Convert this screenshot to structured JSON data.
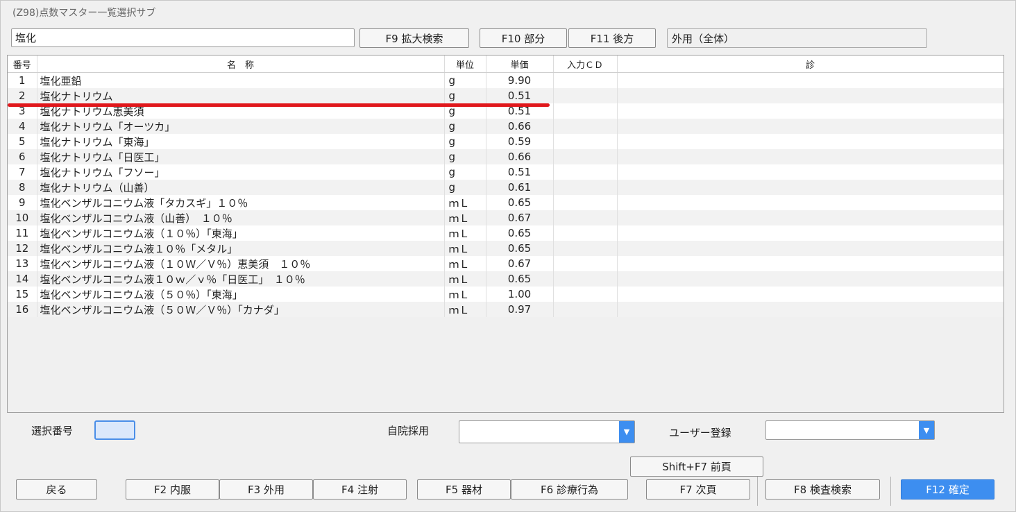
{
  "window": {
    "title": "(Z98)点数マスター一覧選択サブ"
  },
  "search": {
    "value": "塩化"
  },
  "top_buttons": {
    "f9": "F9 拡大検索",
    "f10": "F10 部分",
    "f11": "F11 後方"
  },
  "category_display": "外用（全体）",
  "table": {
    "headers": {
      "no": "番号",
      "name": "名　称",
      "unit": "単位",
      "price": "単価",
      "input_cd": "入力ＣＤ",
      "shin": "診"
    },
    "rows": [
      {
        "no": "1",
        "name": "塩化亜鉛",
        "unit": "g",
        "price": "9.90"
      },
      {
        "no": "2",
        "name": "塩化ナトリウム",
        "unit": "g",
        "price": "0.51"
      },
      {
        "no": "3",
        "name": "塩化ナトリウム恵美須",
        "unit": "g",
        "price": "0.51"
      },
      {
        "no": "4",
        "name": "塩化ナトリウム「オーツカ」",
        "unit": "g",
        "price": "0.66"
      },
      {
        "no": "5",
        "name": "塩化ナトリウム「東海」",
        "unit": "g",
        "price": "0.59"
      },
      {
        "no": "6",
        "name": "塩化ナトリウム「日医工」",
        "unit": "g",
        "price": "0.66"
      },
      {
        "no": "7",
        "name": "塩化ナトリウム「フソー」",
        "unit": "g",
        "price": "0.51"
      },
      {
        "no": "8",
        "name": "塩化ナトリウム（山善）",
        "unit": "g",
        "price": "0.61"
      },
      {
        "no": "9",
        "name": "塩化ベンザルコニウム液「タカスギ」１０％",
        "unit": "ｍＬ",
        "price": "0.65"
      },
      {
        "no": "10",
        "name": "塩化ベンザルコニウム液（山善）　１０％",
        "unit": "ｍＬ",
        "price": "0.67"
      },
      {
        "no": "11",
        "name": "塩化ベンザルコニウム液（１０％）「東海」",
        "unit": "ｍＬ",
        "price": "0.65"
      },
      {
        "no": "12",
        "name": "塩化ベンザルコニウム液１０％「メタル」",
        "unit": "ｍＬ",
        "price": "0.65"
      },
      {
        "no": "13",
        "name": "塩化ベンザルコニウム液（１０Ｗ／Ｖ％）恵美須　１０％",
        "unit": "ｍＬ",
        "price": "0.67"
      },
      {
        "no": "14",
        "name": "塩化ベンザルコニウム液１０ｗ／ｖ％「日医工」　１０％",
        "unit": "ｍＬ",
        "price": "0.65"
      },
      {
        "no": "15",
        "name": "塩化ベンザルコニウム液（５０％）「東海」",
        "unit": "ｍＬ",
        "price": "1.00"
      },
      {
        "no": "16",
        "name": "塩化ベンザルコニウム液（５０Ｗ／Ｖ％）「カナダ」",
        "unit": "ｍＬ",
        "price": "0.97"
      }
    ]
  },
  "form": {
    "selection_label": "選択番号",
    "selection_value": "",
    "in_hospital_label": "自院採用",
    "in_hospital_value": "",
    "user_reg_label": "ユーザー登録",
    "user_reg_value": ""
  },
  "bottom_buttons": {
    "back": "戻る",
    "f2": "F2 内服",
    "f3": "F3 外用",
    "f4": "F4 注射",
    "f5": "F5 器材",
    "f6": "F6 診療行為",
    "shift_f7": "Shift+F7 前頁",
    "f7": "F7 次頁",
    "f8": "F8 検査検索",
    "f12": "F12 確定"
  },
  "icons": {
    "dropdown": "chevron-down-icon"
  },
  "colors": {
    "accent": "#3d8ef0",
    "highlight_line": "#e0171b"
  }
}
